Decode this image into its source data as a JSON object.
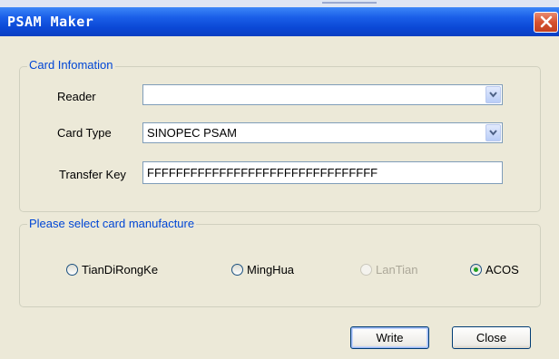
{
  "window": {
    "title": "PSAM Maker"
  },
  "card_info": {
    "legend": "Card Infomation",
    "reader_label": "Reader",
    "reader_value": "",
    "card_type_label": "Card Type",
    "card_type_value": "SINOPEC PSAM",
    "transfer_key_label": "Transfer Key",
    "transfer_key_value": "FFFFFFFFFFFFFFFFFFFFFFFFFFFFFFFF"
  },
  "manufacture": {
    "legend": "Please select card manufacture",
    "options": [
      {
        "label": "TianDiRongKe",
        "selected": false,
        "enabled": true
      },
      {
        "label": "MingHua",
        "selected": false,
        "enabled": true
      },
      {
        "label": "LanTian",
        "selected": false,
        "enabled": false
      },
      {
        "label": "ACOS",
        "selected": true,
        "enabled": true
      }
    ]
  },
  "buttons": {
    "write": "Write",
    "close": "Close"
  },
  "colors": {
    "titlebar": "#0b48d6",
    "legend_text": "#0046d5",
    "dialog_bg": "#ece9d8",
    "close_button": "#d6522f"
  },
  "icons": {
    "close": "close-icon",
    "dropdown": "chevron-down-icon"
  }
}
